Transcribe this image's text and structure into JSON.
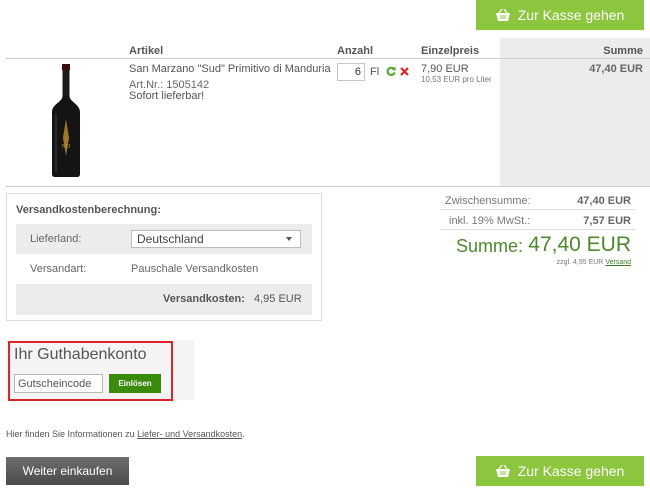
{
  "checkout": {
    "label": "Zur Kasse gehen",
    "icon": "shopping-basket-icon"
  },
  "cart": {
    "headers": {
      "article": "Artikel",
      "quantity": "Anzahl",
      "unit_price": "Einzelpreis",
      "total": "Summe"
    },
    "item": {
      "name": "San Marzano \"Sud\" Primitivo di Manduria",
      "article_no": "Art.Nr.: 1505142",
      "availability": "Sofort lieferbar!",
      "quantity": "6",
      "unit": "Fl",
      "price": "7,90 EUR",
      "price_per_liter": "10,53 EUR pro Liter",
      "total": "47,40 EUR",
      "update_icon": "refresh-icon",
      "remove_icon": "remove-x-icon"
    }
  },
  "shipping": {
    "title": "Versandkostenberechnung:",
    "country_label": "Lieferland:",
    "country_value": "Deutschland",
    "method_label": "Versandart:",
    "method_value": "Pauschale Versandkosten",
    "cost_label": "Versandkosten:",
    "cost_value": "4,95 EUR"
  },
  "totals": {
    "subtotal_label": "Zwischensumme:",
    "subtotal_value": "47,40 EUR",
    "vat_label": "inkl. 19% MwSt.:",
    "vat_value": "7,57 EUR",
    "sum_label": "Summe:",
    "sum_value": "47,40 EUR",
    "shipping_note_prefix": "zzgl. 4,95 EUR",
    "shipping_note_link": "Versand"
  },
  "voucher": {
    "title": "Ihr Guthabenkonto",
    "placeholder": "Gutscheincode",
    "button": "Einlösen"
  },
  "info": {
    "prefix": "Hier finden Sie Informationen zu",
    "link": "Liefer- und Versandkosten",
    "suffix": "."
  },
  "continue_label": "Weiter einkaufen",
  "colors": {
    "accent": "#8cc63f",
    "sum_green": "#4c8a2b",
    "redeem_green": "#3a8a0c",
    "highlight_red": "#d9262c"
  }
}
